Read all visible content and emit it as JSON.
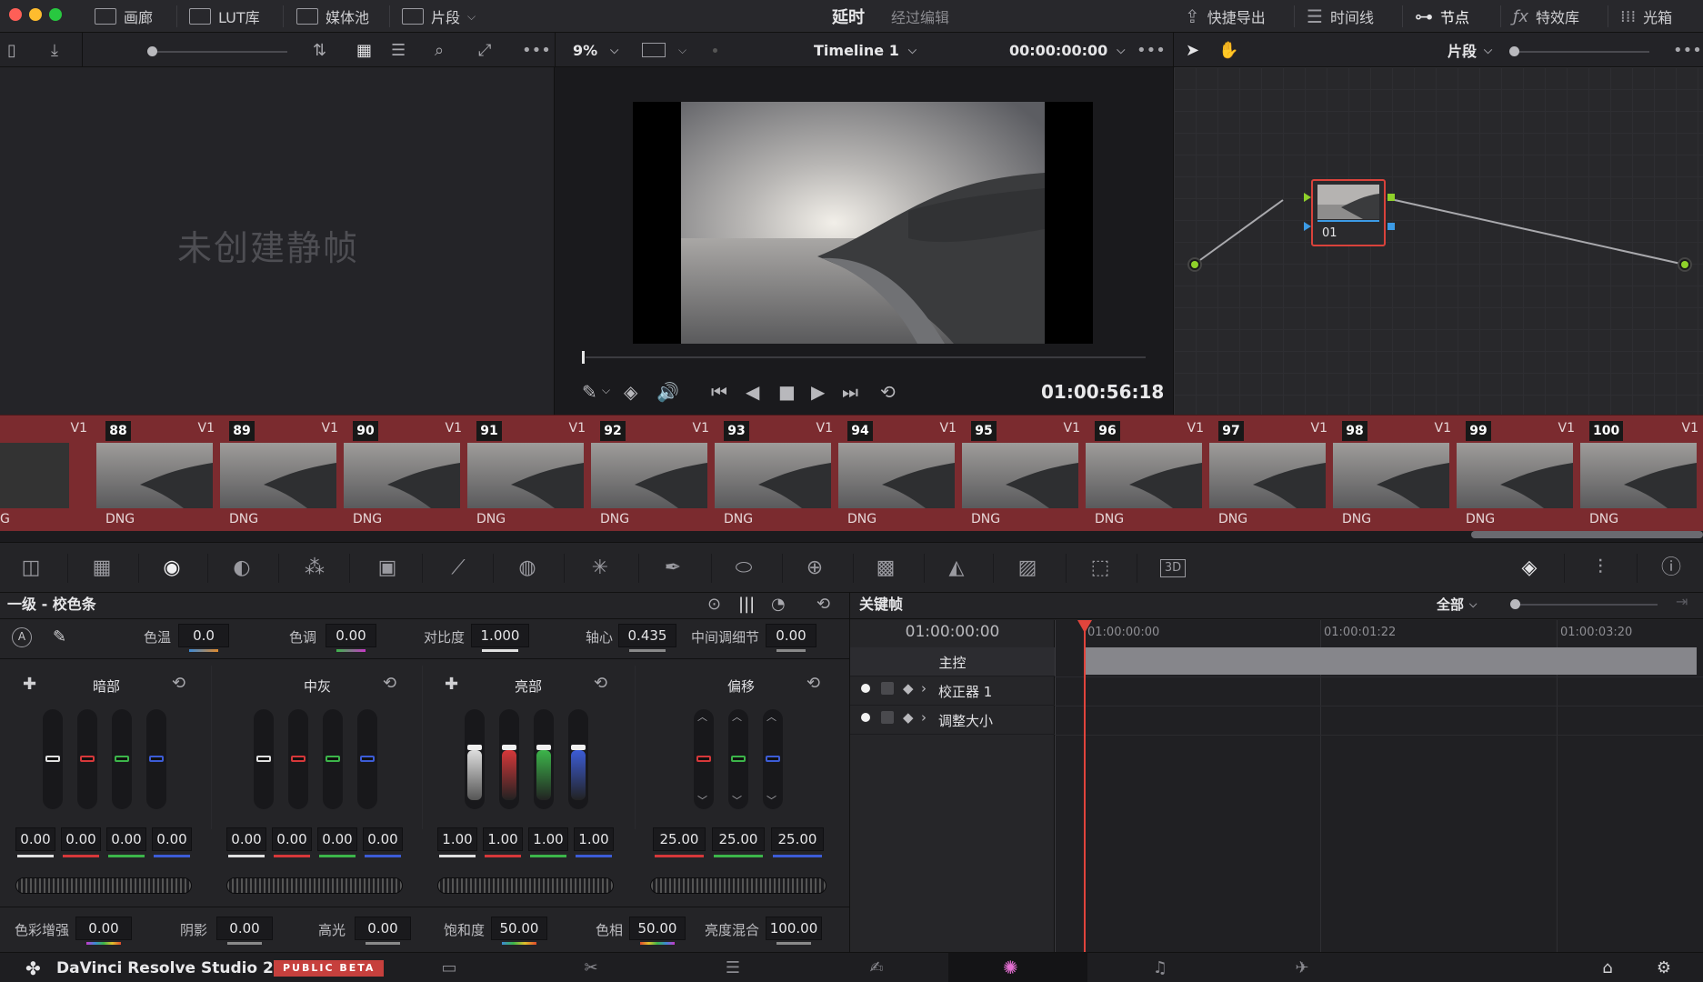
{
  "topbar": {
    "buttons": {
      "gallery": "画廊",
      "lut": "LUT库",
      "media": "媒体池",
      "clips": "片段",
      "quick_export": "快捷导出",
      "timeline": "时间线",
      "nodes": "节点",
      "effects": "特效库",
      "lightbox": "光箱"
    },
    "title": "延时",
    "subtitle": "经过编辑"
  },
  "toolbar2": {
    "zoom": "9%",
    "timeline_name": "Timeline 1",
    "timecode": "00:00:00:00",
    "node_mode": "片段"
  },
  "gallery": {
    "empty_text": "未创建静帧"
  },
  "viewer": {
    "timecode": "01:00:56:18"
  },
  "nodes": {
    "node_label": "01"
  },
  "filmstrip": {
    "first_fragment": {
      "track": "V1",
      "fmt": "G"
    },
    "clips": [
      {
        "num": "88",
        "track": "V1",
        "fmt": "DNG"
      },
      {
        "num": "89",
        "track": "V1",
        "fmt": "DNG"
      },
      {
        "num": "90",
        "track": "V1",
        "fmt": "DNG"
      },
      {
        "num": "91",
        "track": "V1",
        "fmt": "DNG"
      },
      {
        "num": "92",
        "track": "V1",
        "fmt": "DNG"
      },
      {
        "num": "93",
        "track": "V1",
        "fmt": "DNG"
      },
      {
        "num": "94",
        "track": "V1",
        "fmt": "DNG"
      },
      {
        "num": "95",
        "track": "V1",
        "fmt": "DNG"
      },
      {
        "num": "96",
        "track": "V1",
        "fmt": "DNG"
      },
      {
        "num": "97",
        "track": "V1",
        "fmt": "DNG"
      },
      {
        "num": "98",
        "track": "V1",
        "fmt": "DNG"
      },
      {
        "num": "99",
        "track": "V1",
        "fmt": "DNG"
      },
      {
        "num": "100",
        "track": "V1",
        "fmt": "DNG"
      }
    ]
  },
  "wheels": {
    "title": "一级 - 校色条",
    "top_params": [
      {
        "label": "色温",
        "value": "0.0"
      },
      {
        "label": "色调",
        "value": "0.00"
      },
      {
        "label": "对比度",
        "value": "1.000"
      },
      {
        "label": "轴心",
        "value": "0.435"
      },
      {
        "label": "中间调细节",
        "value": "0.00"
      }
    ],
    "groups": [
      {
        "title": "暗部",
        "values": [
          "0.00",
          "0.00",
          "0.00",
          "0.00"
        ],
        "fill": [
          0.5,
          0.5,
          0.5,
          0.5
        ]
      },
      {
        "title": "中灰",
        "values": [
          "0.00",
          "0.00",
          "0.00",
          "0.00"
        ],
        "fill": [
          0.5,
          0.5,
          0.5,
          0.5
        ]
      },
      {
        "title": "亮部",
        "values": [
          "1.00",
          "1.00",
          "1.00",
          "1.00"
        ],
        "fill": [
          0.5,
          0.5,
          0.5,
          0.5
        ]
      },
      {
        "title": "偏移",
        "values": [
          "25.00",
          "25.00",
          "25.00"
        ],
        "fill": [
          0.5,
          0.5,
          0.5
        ]
      }
    ],
    "bottom_params": [
      {
        "label": "色彩增强",
        "value": "0.00"
      },
      {
        "label": "阴影",
        "value": "0.00"
      },
      {
        "label": "高光",
        "value": "0.00"
      },
      {
        "label": "饱和度",
        "value": "50.00"
      },
      {
        "label": "色相",
        "value": "50.00"
      },
      {
        "label": "亮度混合",
        "value": "100.00"
      }
    ],
    "colors": {
      "white": "#e0e0e0",
      "red": "#d6383a",
      "green": "#3cb54a",
      "blue": "#3c5cd6"
    }
  },
  "keyframes": {
    "title": "关键帧",
    "filter": "全部",
    "current_tc": "01:00:00:00",
    "ruler": [
      "01:00:00:00",
      "01:00:01:22",
      "01:00:03:20"
    ],
    "rows": [
      "主控",
      "校正器 1",
      "调整大小"
    ]
  },
  "bottombar": {
    "brand": "DaVinci Resolve Studio 20",
    "badge": "PUBLIC BETA"
  }
}
